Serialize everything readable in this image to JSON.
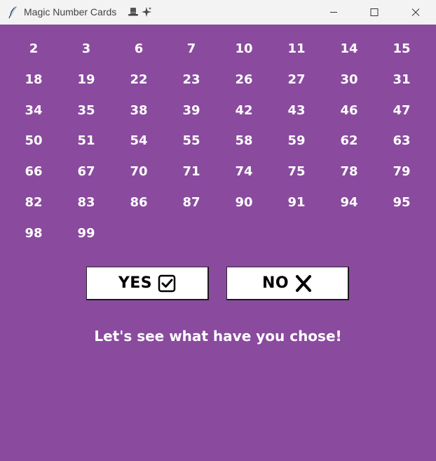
{
  "window": {
    "title": "Magic Number Cards",
    "title_icons": [
      "tophat-icon",
      "sparkles-icon"
    ],
    "app_icon": "feather-icon",
    "controls": [
      "minimize-icon",
      "maximize-icon",
      "close-icon"
    ]
  },
  "theme": {
    "background": "#8a4a9e",
    "number_color": "#ffffff",
    "button_bg": "#ffffff"
  },
  "numbers": [
    "2",
    "3",
    "6",
    "7",
    "10",
    "11",
    "14",
    "15",
    "18",
    "19",
    "22",
    "23",
    "26",
    "27",
    "30",
    "31",
    "34",
    "35",
    "38",
    "39",
    "42",
    "43",
    "46",
    "47",
    "50",
    "51",
    "54",
    "55",
    "58",
    "59",
    "62",
    "63",
    "66",
    "67",
    "70",
    "71",
    "74",
    "75",
    "78",
    "79",
    "82",
    "83",
    "86",
    "87",
    "90",
    "91",
    "94",
    "95",
    "98",
    "99"
  ],
  "buttons": {
    "yes_label": "YES",
    "yes_icon": "checkbox-check-icon",
    "no_label": "NO",
    "no_icon": "x-icon"
  },
  "message": "Let's see what have you chose!"
}
